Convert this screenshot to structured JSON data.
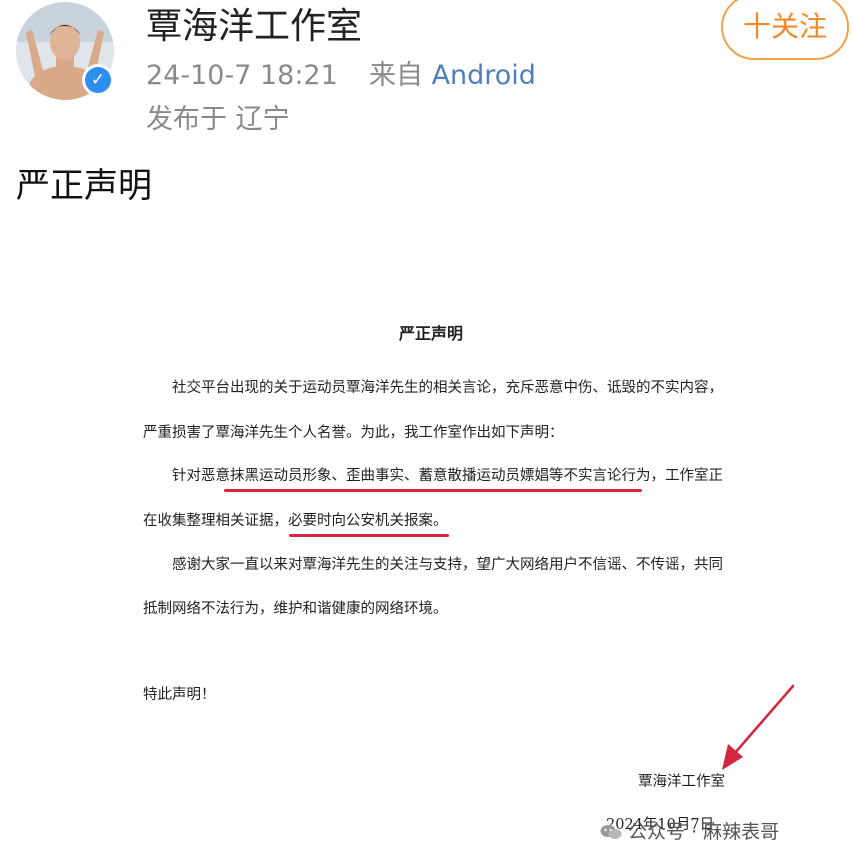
{
  "post": {
    "author_name": "覃海洋工作室",
    "time": "24-10-7 18:21",
    "source_prefix": "来自",
    "device": "Android",
    "location": "发布于 辽宁",
    "follow_label": "十关注",
    "text": "严正声明"
  },
  "document": {
    "title": "严正声明",
    "para1_line1": "社交平台出现的关于运动员覃海洋先生的相关言论，充斥恶意中伤、诋毁的不实内容，",
    "para1_line2": "严重损害了覃海洋先生个人名誉。为此，我工作室作出如下声明：",
    "para2_line1": "针对恶意抹黑运动员形象、歪曲事实、蓄意散播运动员嫖娼等不实言论行为，工作室正",
    "para2_line2": "在收集整理相关证据，必要时向公安机关报案。",
    "para3_line1": "感谢大家一直以来对覃海洋先生的关注与支持，望广大网络用户不信谣、不传谣，共同",
    "para3_line2": "抵制网络不法行为，维护和谐健康的网络环境。",
    "closing": "特此声明！",
    "signature": "覃海洋工作室",
    "date": "2024年10月7日"
  },
  "watermark": {
    "text": "公众号 · 麻辣表哥"
  },
  "colors": {
    "follow_border": "#f0a34a",
    "follow_text": "#f08a2b",
    "verified_badge": "#2f8ff0",
    "device_link": "#4f7fb8",
    "annotation_red": "#d6263f"
  },
  "icons": {
    "verified": "verified-check-icon",
    "watermark": "wechat-icon",
    "annotation": "arrow-icon"
  }
}
